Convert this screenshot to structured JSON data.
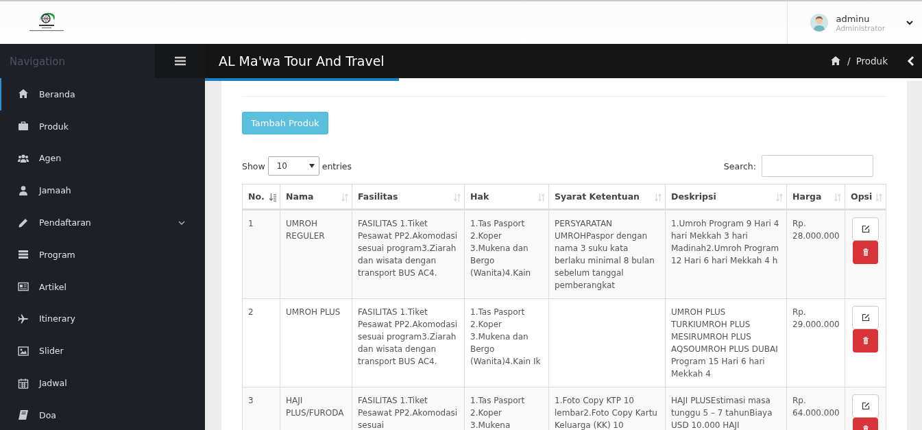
{
  "header": {
    "user": {
      "name": "adminu",
      "role": "Administrator"
    }
  },
  "sidebar": {
    "title": "Navigation",
    "items": [
      {
        "label": "Beranda",
        "kind": "home",
        "selected": true,
        "expandable": false
      },
      {
        "label": "Produk",
        "kind": "briefcase",
        "selected": false,
        "expandable": false
      },
      {
        "label": "Agen",
        "kind": "users",
        "selected": false,
        "expandable": false
      },
      {
        "label": "Jamaah",
        "kind": "user",
        "selected": false,
        "expandable": false
      },
      {
        "label": "Pendaftaran",
        "kind": "pencil",
        "selected": false,
        "expandable": true
      },
      {
        "label": "Program",
        "kind": "list",
        "selected": false,
        "expandable": false
      },
      {
        "label": "Artikel",
        "kind": "newspaper",
        "selected": false,
        "expandable": false
      },
      {
        "label": "Itinerary",
        "kind": "plane",
        "selected": false,
        "expandable": false
      },
      {
        "label": "Slider",
        "kind": "image",
        "selected": false,
        "expandable": false
      },
      {
        "label": "Jadwal",
        "kind": "calendar",
        "selected": false,
        "expandable": false
      },
      {
        "label": "Doa",
        "kind": "book",
        "selected": false,
        "expandable": false
      }
    ]
  },
  "page": {
    "title": "AL Ma'wa Tour And Travel",
    "breadcrumb": [
      {
        "separator": "/",
        "label": "Produk"
      }
    ]
  },
  "content": {
    "add_button": "Tambah Produk",
    "show_label": "Show",
    "entries_value": "10",
    "entries_label": "entries",
    "search_label": "Search:",
    "table": {
      "columns": [
        {
          "label": "No.",
          "sorted": true
        },
        {
          "label": "Nama",
          "sorted": false
        },
        {
          "label": "Fasilitas",
          "sorted": false
        },
        {
          "label": "Hak",
          "sorted": false
        },
        {
          "label": "Syarat Ketentuan",
          "sorted": false
        },
        {
          "label": "Deskripsi",
          "sorted": false
        },
        {
          "label": "Harga",
          "sorted": false
        },
        {
          "label": "Opsi",
          "sorted": false
        }
      ],
      "rows": [
        {
          "no": "1",
          "nama": "UMROH REGULER",
          "fasilitas": "FASILITAS 1.Tiket Pesawat PP2.Akomodasi sesuai program3.Ziarah dan wisata dengan transport BUS AC4.",
          "hak": "1.Tas Pasport 2.Koper 3.Mukena dan Bergo (Wanita)4.Kain",
          "syarat": "PERSYARATAN UMROHPaspor dengan nama 3 suku kata berlaku minimal 8 bulan sebelum tanggal pemberangkat",
          "deskripsi": "1.Umroh Program 9 Hari 4 hari Mekkah 3 hari Madinah2.Umroh Program 12 Hari 6 hari Mekkah 4 h",
          "harga": "Rp. 28.000.000"
        },
        {
          "no": "2",
          "nama": "UMROH PLUS",
          "fasilitas": "FASILITAS 1.Tiket Pesawat PP2.Akomodasi sesuai program3.Ziarah dan wisata dengan transport BUS AC4.",
          "hak": "1.Tas Pasport 2.Koper 3.Mukena dan Bergo (Wanita)4.Kain Ik",
          "syarat": "",
          "deskripsi": "UMROH PLUS TURKIUMROH PLUS MESIRUMROH PLUS AQSOUMROH PLUS DUBAI Program 15 Hari 6 hari Mekkah 4",
          "harga": "Rp. 29.000.000"
        },
        {
          "no": "3",
          "nama": "HAJI PLUS/FURODA",
          "fasilitas": "FASILITAS 1.Tiket Pesawat PP2.Akomodasi sesuai",
          "hak": "1.Tas Pasport 2.Koper 3.Mukena",
          "syarat": "1.Foto Copy KTP 10 lembar2.Foto Copy Kartu Keluarga (KK) 10",
          "deskripsi": "HAJI PLUSEstimasi masa tunggu 5 – 7 tahunBiaya USD 10.000 HAJI",
          "harga": "Rp. 64.000.000"
        }
      ]
    }
  }
}
